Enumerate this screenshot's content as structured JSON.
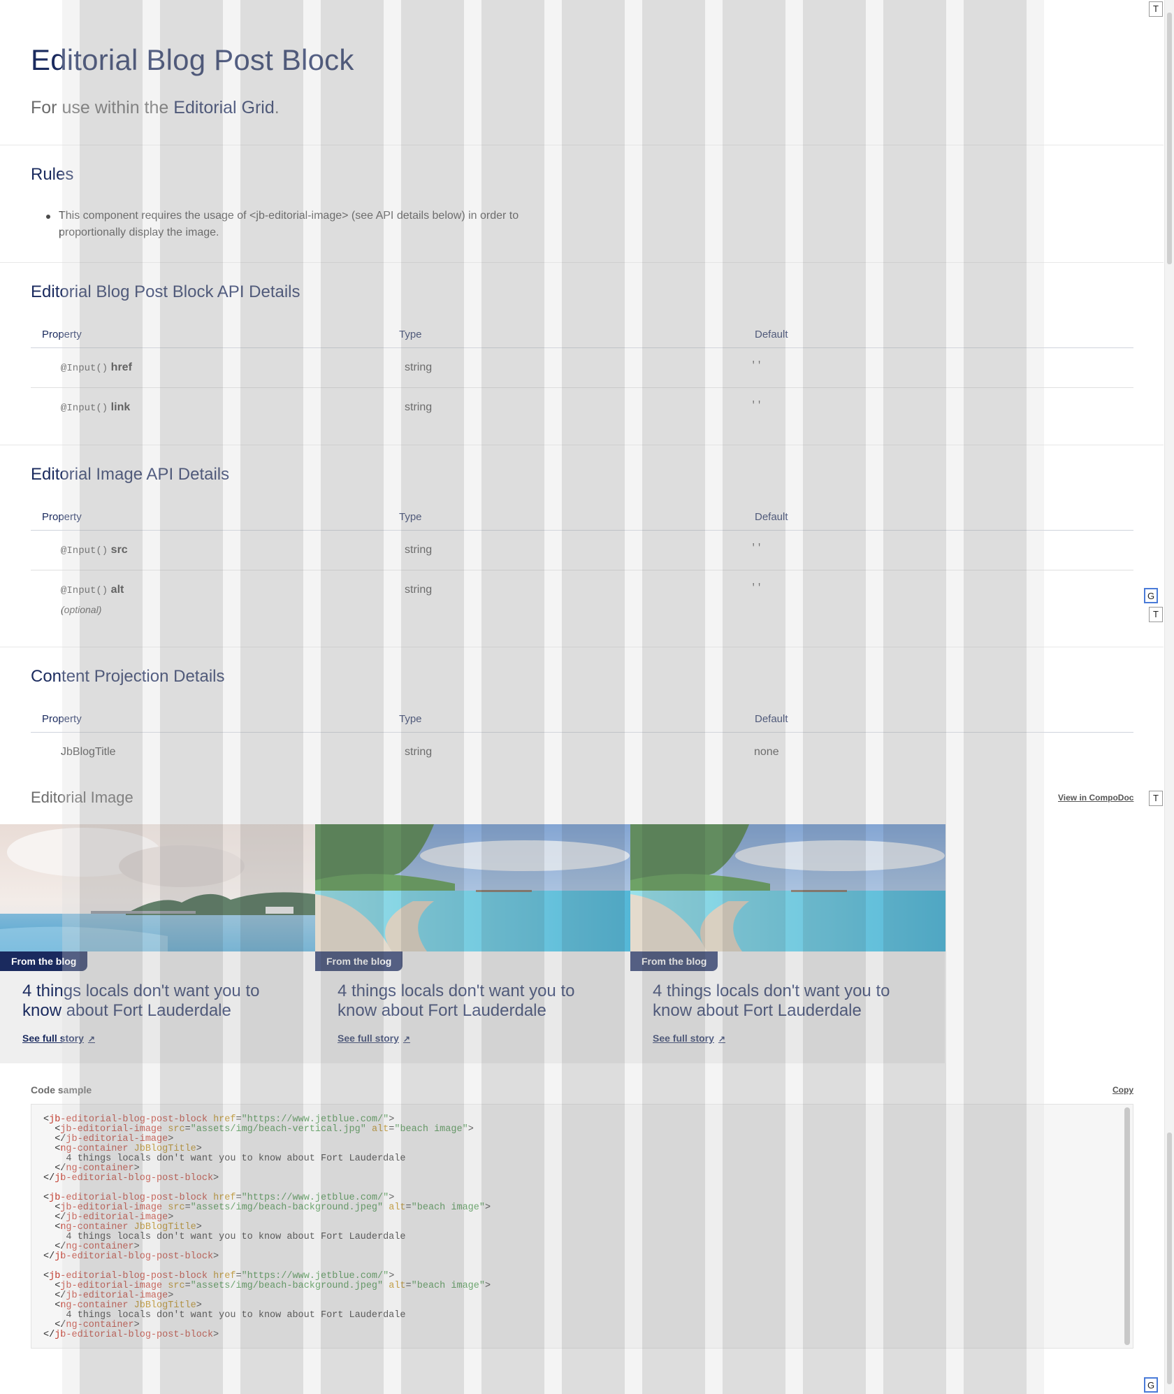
{
  "header": {
    "title": "Editorial Blog Post Block",
    "subtitle_prefix": "For use within the ",
    "subtitle_link": "Editorial Grid",
    "subtitle_suffix": "."
  },
  "rules": {
    "heading": "Rules",
    "items": [
      "This component requires the usage of <jb-editorial-image> (see API details below) in order to proportionally display the image."
    ]
  },
  "tables": {
    "columns": [
      "Property",
      "Type",
      "Default"
    ],
    "blog_api": {
      "heading": "Editorial Blog Post Block API Details",
      "rows": [
        {
          "decorator": "@Input()",
          "name": "href",
          "type": "string",
          "default": "''"
        },
        {
          "decorator": "@Input()",
          "name": "link",
          "type": "string",
          "default": "''"
        }
      ]
    },
    "image_api": {
      "heading": "Editorial Image API Details",
      "rows": [
        {
          "decorator": "@Input()",
          "name": "src",
          "type": "string",
          "default": "''"
        },
        {
          "decorator": "@Input()",
          "name": "alt",
          "optional": "(optional)",
          "type": "string",
          "default": "''"
        }
      ]
    },
    "projection": {
      "heading": "Content Projection Details",
      "rows": [
        {
          "name": "JbBlogTitle",
          "type": "string",
          "default": "none"
        }
      ]
    }
  },
  "example": {
    "title": "Editorial Image",
    "compodoc_link": "View in CompoDoc",
    "cards": [
      {
        "badge": "From the blog",
        "title": "4 things locals don't want you to know about Fort Lauderdale",
        "link": "See full story",
        "link_icon": "external-arrow-icon"
      },
      {
        "badge": "From the blog",
        "title": "4 things locals don't want you to know about Fort Lauderdale",
        "link": "See full story",
        "link_icon": "external-arrow-icon"
      },
      {
        "badge": "From the blog",
        "title": "4 things locals don't want you to know about Fort Lauderdale",
        "link": "See full story",
        "link_icon": "external-arrow-icon"
      }
    ]
  },
  "code": {
    "label": "Code sample",
    "copy_label": "Copy",
    "blocks": [
      {
        "href": "\"https://www.jetblue.com/\"",
        "src": "\"assets/img/beach-vertical.jpg\"",
        "alt": "\"beach image\"",
        "text": "4 things locals don't want you to know about Fort Lauderdale"
      },
      {
        "href": "\"https://www.jetblue.com/\"",
        "src": "\"assets/img/beach-background.jpeg\"",
        "alt": "\"beach image\"",
        "text": "4 things locals don't want you to know about Fort Lauderdale"
      },
      {
        "href": "\"https://www.jetblue.com/\"",
        "src": "\"assets/img/beach-background.jpeg\"",
        "alt": "\"beach image\"",
        "text": "4 things locals don't want you to know about Fort Lauderdale"
      }
    ]
  },
  "tools": {
    "t": "T",
    "g": "G"
  },
  "colors": {
    "brand_navy": "#1a2a5e",
    "code_tag": "#c0392b",
    "code_attr": "#b8860b",
    "code_string": "#3e8e41"
  }
}
